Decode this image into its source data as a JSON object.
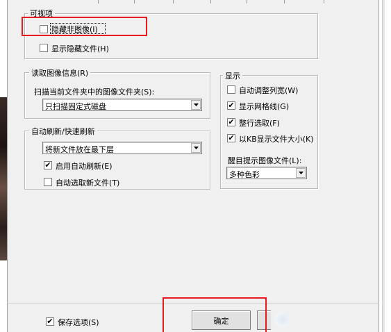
{
  "visible": {
    "legend": "可视项",
    "hide_non_image": {
      "label": "隐藏非图像(I)",
      "checked": false
    },
    "show_hidden_files": {
      "label": "显示隐藏文件(H)",
      "checked": false
    }
  },
  "read_info": {
    "legend": "读取图像信息(R)",
    "scan_label": "扫描当前文件夹中的图像文件夹(S):",
    "scan_value": "只扫描固定式磁盘"
  },
  "display": {
    "legend": "显示",
    "items": [
      {
        "label": "自动调整列宽(W)",
        "checked": false,
        "mark": ""
      },
      {
        "label": "显示网格线(G)",
        "checked": true,
        "mark": "✔"
      },
      {
        "label": "整行选取(F)",
        "checked": true,
        "mark": "✔"
      },
      {
        "label": "以KB显示文件大小(K)",
        "checked": true,
        "mark": "✔"
      }
    ],
    "highlight_label": "醒目提示图像文件(L):",
    "highlight_value": "多种色彩"
  },
  "refresh": {
    "legend": "自动刷新/快速刷新",
    "position_value": "将新文件放在最下层",
    "enable_auto": {
      "label": "启用自动刷新(E)",
      "checked": true,
      "mark": "✔"
    },
    "auto_select": {
      "label": "自动选取新文件(T)",
      "checked": false,
      "mark": ""
    }
  },
  "footer": {
    "save_options": {
      "label": "保存选项(S)",
      "checked": true,
      "mark": "✔"
    },
    "ok_label": "确定"
  },
  "colors": {
    "highlight_red": "#e8191f",
    "panel_bg": "#f0f0f0"
  }
}
